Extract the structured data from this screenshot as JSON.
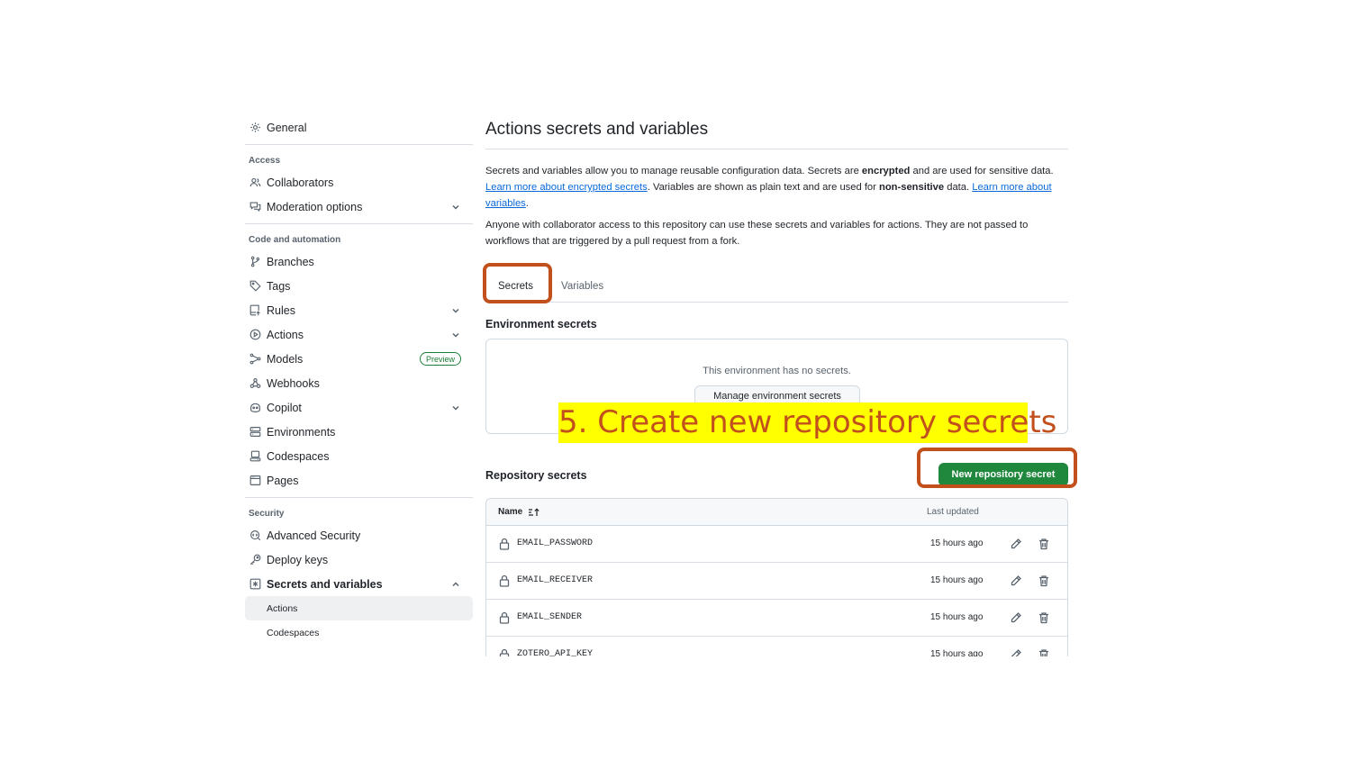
{
  "sidebar": {
    "general": {
      "label": "General",
      "icon": "gear-icon"
    },
    "sections": [
      {
        "heading": "Access",
        "items": [
          {
            "label": "Collaborators",
            "icon": "people-icon",
            "chevron": false
          },
          {
            "label": "Moderation options",
            "icon": "comment-discussion-icon",
            "chevron": true
          }
        ]
      },
      {
        "heading": "Code and automation",
        "items": [
          {
            "label": "Branches",
            "icon": "git-branch-icon"
          },
          {
            "label": "Tags",
            "icon": "tag-icon"
          },
          {
            "label": "Rules",
            "icon": "repo-push-icon"
          },
          {
            "label": "Actions",
            "icon": "play-icon"
          },
          {
            "label": "Models",
            "icon": "models-icon",
            "badge": "Preview"
          },
          {
            "label": "Webhooks",
            "icon": "webhook-icon"
          },
          {
            "label": "Copilot",
            "icon": "copilot-icon"
          },
          {
            "label": "Environments",
            "icon": "server-icon"
          },
          {
            "label": "Codespaces",
            "icon": "codespaces-icon"
          },
          {
            "label": "Pages",
            "icon": "browser-icon"
          }
        ]
      },
      {
        "heading": "Security",
        "items": [
          {
            "label": "Advanced Security",
            "icon": "codescan-icon"
          },
          {
            "label": "Deploy keys",
            "icon": "key-icon"
          },
          {
            "label": "Secrets and variables",
            "icon": "asterisk-icon",
            "expanded": true
          },
          {
            "label": "Actions",
            "active": true
          },
          {
            "label": "Codespaces"
          }
        ]
      }
    ]
  },
  "main": {
    "title": "Actions secrets and variables",
    "intro": {
      "t1": "Secrets and variables allow you to manage reusable configuration data. Secrets are ",
      "b1": "encrypted",
      "t2": " and are used for sensitive data. ",
      "link1": "Learn more about encrypted secrets",
      "t3": ". Variables are shown as plain text and are used for ",
      "b2": "non-sensitive",
      "t4": " data. ",
      "link2": "Learn more about variables",
      "t5": "."
    },
    "access_note": "Anyone with collaborator access to this repository can use these secrets and variables for actions. They are not passed to workflows that are triggered by a pull request from a fork.",
    "tabs": [
      {
        "label": "Secrets",
        "active": true
      },
      {
        "label": "Variables",
        "active": false
      }
    ],
    "environment": {
      "title": "Environment secrets",
      "empty_text": "This environment has no secrets.",
      "button": "Manage environment secrets"
    },
    "repository": {
      "title": "Repository secrets",
      "new_button": "New repository secret",
      "columns": {
        "name": "Name",
        "updated": "Last updated"
      },
      "rows": [
        {
          "name": "EMAIL_PASSWORD",
          "updated": "15 hours ago"
        },
        {
          "name": "EMAIL_RECEIVER",
          "updated": "15 hours ago"
        },
        {
          "name": "EMAIL_SENDER",
          "updated": "15 hours ago"
        },
        {
          "name": "ZOTERO_API_KEY",
          "updated": "15 hours ago"
        }
      ]
    }
  },
  "annotation": {
    "callout": "5. Create new repository secrets",
    "highlight_color": "#c2501c",
    "callout_bg": "#ffff00"
  },
  "colors": {
    "primary_button": "#1f883d",
    "link": "#0969da",
    "tab_underline": "#fd8c73",
    "preview_badge": "#1a7f37"
  }
}
